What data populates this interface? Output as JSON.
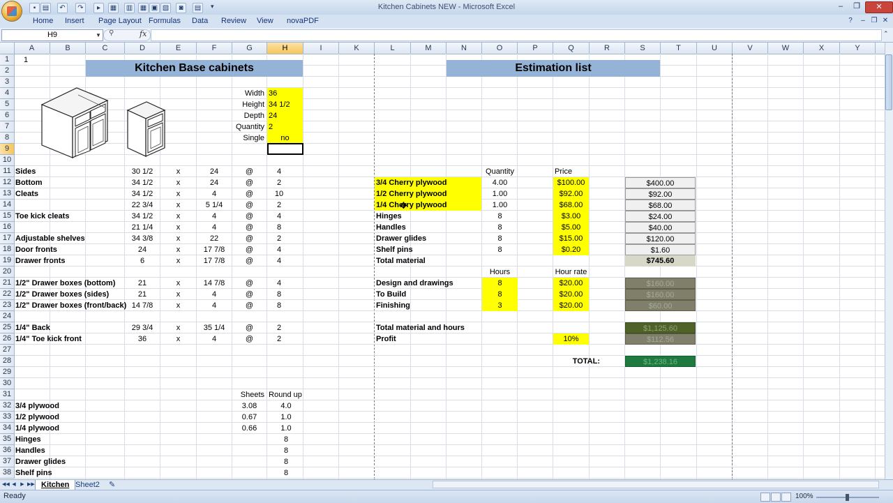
{
  "window": {
    "title": "Kitchen Cabinets NEW - Microsoft Excel"
  },
  "ribbon": {
    "tabs": [
      "Home",
      "Insert",
      "Page Layout",
      "Formulas",
      "Data",
      "Review",
      "View",
      "novaPDF"
    ]
  },
  "formula_bar": {
    "name_box": "H9",
    "fx": "fx",
    "value": ""
  },
  "columns": [
    "A",
    "B",
    "C",
    "D",
    "E",
    "F",
    "G",
    "H",
    "I",
    "K",
    "L",
    "M",
    "N",
    "O",
    "P",
    "Q",
    "R",
    "S",
    "T",
    "U",
    "V",
    "W",
    "X",
    "Y"
  ],
  "selected_column": "H",
  "selected_row": "9",
  "rows": [
    "1",
    "2",
    "3",
    "4",
    "5",
    "6",
    "7",
    "8",
    "9",
    "10",
    "11",
    "12",
    "13",
    "14",
    "15",
    "16",
    "17",
    "18",
    "19",
    "20",
    "21",
    "22",
    "23",
    "24",
    "25",
    "26",
    "27",
    "28",
    "29",
    "30",
    "31",
    "32",
    "33",
    "34",
    "35",
    "36",
    "37",
    "38"
  ],
  "sheet": {
    "a1": "1",
    "title_left": "Kitchen Base cabinets",
    "title_right": "Estimation list",
    "inputs": [
      {
        "label": "Width",
        "value": "36"
      },
      {
        "label": "Height",
        "value": "34 1/2"
      },
      {
        "label": "Depth",
        "value": "24"
      },
      {
        "label": "Quantity",
        "value": "2"
      },
      {
        "label": "Single",
        "value": "no"
      }
    ],
    "cut_list": [
      {
        "row": "11",
        "part": "Sides",
        "d": "30 1/2",
        "x": "x",
        "f": "24",
        "at": "@",
        "qty": "4"
      },
      {
        "row": "12",
        "part": "Bottom",
        "d": "34 1/2",
        "x": "x",
        "f": "24",
        "at": "@",
        "qty": "2"
      },
      {
        "row": "13",
        "part": "Cleats",
        "d": "34 1/2",
        "x": "x",
        "f": "4",
        "at": "@",
        "qty": "10"
      },
      {
        "row": "14",
        "part": "",
        "d": "22 3/4",
        "x": "x",
        "f": "5 1/4",
        "at": "@",
        "qty": "2"
      },
      {
        "row": "15",
        "part": "Toe kick cleats",
        "d": "34 1/2",
        "x": "x",
        "f": "4",
        "at": "@",
        "qty": "4"
      },
      {
        "row": "16",
        "part": "",
        "d": "21 1/4",
        "x": "x",
        "f": "4",
        "at": "@",
        "qty": "8"
      },
      {
        "row": "17",
        "part": "Adjustable shelves",
        "d": "34 3/8",
        "x": "x",
        "f": "22",
        "at": "@",
        "qty": "2"
      },
      {
        "row": "18",
        "part": "Door fronts",
        "d": "24",
        "x": "x",
        "f": "17 7/8",
        "at": "@",
        "qty": "4"
      },
      {
        "row": "19",
        "part": "Drawer fronts",
        "d": "6",
        "x": "x",
        "f": "17 7/8",
        "at": "@",
        "qty": "4"
      },
      {
        "row": "21",
        "part": "1/2\" Drawer boxes (bottom)",
        "d": "21",
        "x": "x",
        "f": "14 7/8",
        "at": "@",
        "qty": "4"
      },
      {
        "row": "22",
        "part": "1/2\" Drawer boxes (sides)",
        "d": "21",
        "x": "x",
        "f": "4",
        "at": "@",
        "qty": "8"
      },
      {
        "row": "23",
        "part": "1/2\" Drawer boxes (front/back)",
        "d": "14 7/8",
        "x": "x",
        "f": "4",
        "at": "@",
        "qty": "8"
      },
      {
        "row": "25",
        "part": "1/4\" Back",
        "d": "29 3/4",
        "x": "x",
        "f": "35 1/4",
        "at": "@",
        "qty": "2"
      },
      {
        "row": "26",
        "part": "1/4\" Toe kick front",
        "d": "36",
        "x": "x",
        "f": "4",
        "at": "@",
        "qty": "2"
      }
    ],
    "sheets_header": {
      "sheets": "Sheets",
      "round_up": "Round up"
    },
    "sheets_list": [
      {
        "label": "3/4 plywood",
        "sheets": "3.08",
        "round": "4.0"
      },
      {
        "label": "1/2 plywood",
        "sheets": "0.67",
        "round": "1.0"
      },
      {
        "label": "1/4 plywood",
        "sheets": "0.66",
        "round": "1.0"
      },
      {
        "label": "Hinges",
        "sheets": "",
        "round": "8"
      },
      {
        "label": "Handles",
        "sheets": "",
        "round": "8"
      },
      {
        "label": "Drawer glides",
        "sheets": "",
        "round": "8"
      },
      {
        "label": "Shelf pins",
        "sheets": "",
        "round": "8"
      }
    ],
    "estimation": {
      "quantity_header": "Quantity",
      "price_header": "Price",
      "materials": [
        {
          "name": "3/4 Cherry plywood",
          "qty": "4.00",
          "price": "$100.00",
          "total": "$400.00"
        },
        {
          "name": "1/2 Cherry plywood",
          "qty": "1.00",
          "price": "$92.00",
          "total": "$92.00"
        },
        {
          "name": "1/4 Cherry plywood",
          "qty": "1.00",
          "price": "$68.00",
          "total": "$68.00"
        },
        {
          "name": "Hinges",
          "qty": "8",
          "price": "$3.00",
          "total": "$24.00"
        },
        {
          "name": "Handles",
          "qty": "8",
          "price": "$5.00",
          "total": "$40.00"
        },
        {
          "name": "Drawer glides",
          "qty": "8",
          "price": "$15.00",
          "total": "$120.00"
        },
        {
          "name": "Shelf pins",
          "qty": "8",
          "price": "$0.20",
          "total": "$1.60"
        }
      ],
      "total_material_label": "Total material",
      "total_material": "$745.60",
      "hours_header": "Hours",
      "rate_header": "Hour rate",
      "labor": [
        {
          "name": "Design and drawings",
          "hours": "8",
          "rate": "$20.00",
          "total": "$160.00"
        },
        {
          "name": "To Build",
          "hours": "8",
          "rate": "$20.00",
          "total": "$160.00"
        },
        {
          "name": "Finishing",
          "hours": "3",
          "rate": "$20.00",
          "total": "$60.00"
        }
      ],
      "total_mh_label": "Total material and hours",
      "total_mh": "$1,125.60",
      "profit_label": "Profit",
      "profit_pct": "10%",
      "profit_value": "$112.56",
      "grand_total_label": "TOTAL:",
      "grand_total": "$1,238.16"
    }
  },
  "sheet_tabs": [
    "Kitchen",
    "Sheet2"
  ],
  "status": {
    "text": "Ready",
    "zoom": "100%"
  }
}
